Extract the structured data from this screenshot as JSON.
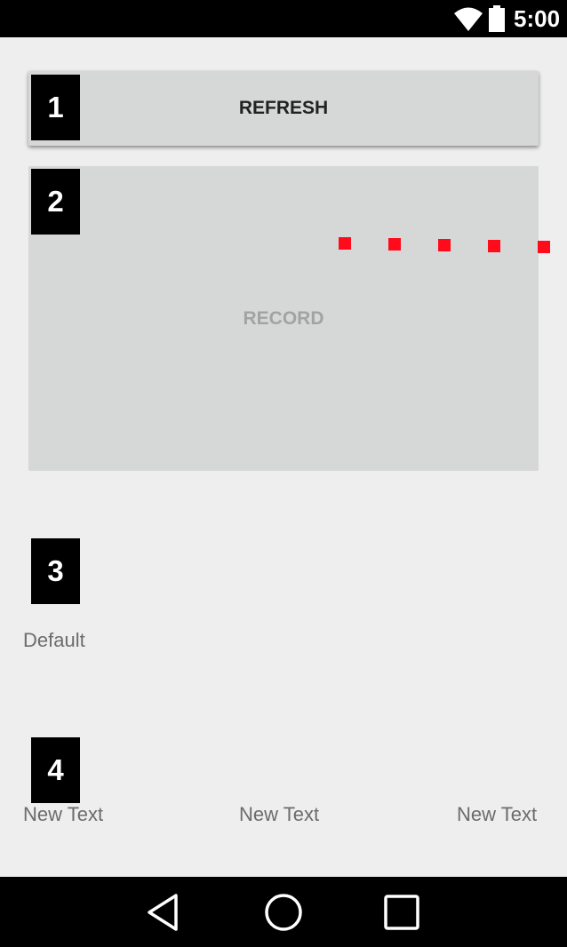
{
  "status_bar": {
    "time": "5:00",
    "wifi_icon": "wifi-icon",
    "battery_icon": "battery-icon"
  },
  "badges": [
    "1",
    "2",
    "3",
    "4"
  ],
  "refresh_button": {
    "label": "REFRESH"
  },
  "record_button": {
    "label": "RECORD",
    "enabled": false
  },
  "indicator_dots": {
    "count": 5,
    "color": "#ff0b1c"
  },
  "default_text": "Default",
  "text_row": [
    "New Text",
    "New Text",
    "New Text"
  ],
  "nav_bar": {
    "back_icon": "back-triangle-icon",
    "home_icon": "home-circle-icon",
    "recents_icon": "recents-square-icon"
  },
  "colors": {
    "background": "#eeeeee",
    "button": "#d6d7d7",
    "badge": "#000000",
    "accent_dot": "#ff0b1c"
  }
}
